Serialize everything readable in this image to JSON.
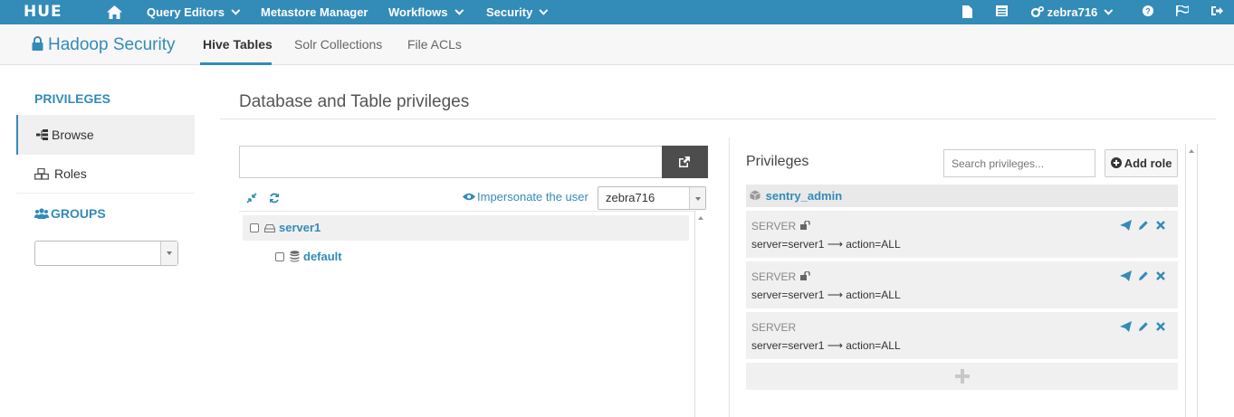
{
  "navbar": {
    "logo": "HUE",
    "menu": [
      "Query Editors",
      "Metastore Manager",
      "Workflows",
      "Security"
    ],
    "user": "zebra716"
  },
  "app": {
    "title": "Hadoop Security",
    "tabs": [
      "Hive Tables",
      "Solr Collections",
      "File ACLs"
    ]
  },
  "sidebar": {
    "privileges_heading": "PRIVILEGES",
    "items": [
      "Browse",
      "Roles"
    ],
    "groups_heading": "GROUPS",
    "groups_selected": ""
  },
  "main": {
    "title": "Database and Table privileges",
    "path_value": "",
    "impersonate_label": "Impersonate the user",
    "impersonate_user": "zebra716",
    "tree": {
      "server": "server1",
      "database": "default"
    }
  },
  "privileges_panel": {
    "title": "Privileges",
    "search_placeholder": "Search privileges...",
    "add_role": "Add role",
    "role": "sentry_admin",
    "cards": [
      {
        "type": "SERVER",
        "desc": "server=server1 ⟶ action=ALL",
        "locked": true
      },
      {
        "type": "SERVER",
        "desc": "server=server1 ⟶ action=ALL",
        "locked": true
      },
      {
        "type": "SERVER",
        "desc": "server=server1 ⟶ action=ALL",
        "locked": false
      }
    ]
  },
  "colors": {
    "brand": "#338bb8",
    "navbar": "#338bb8",
    "path_button": "#4d4d4d"
  }
}
